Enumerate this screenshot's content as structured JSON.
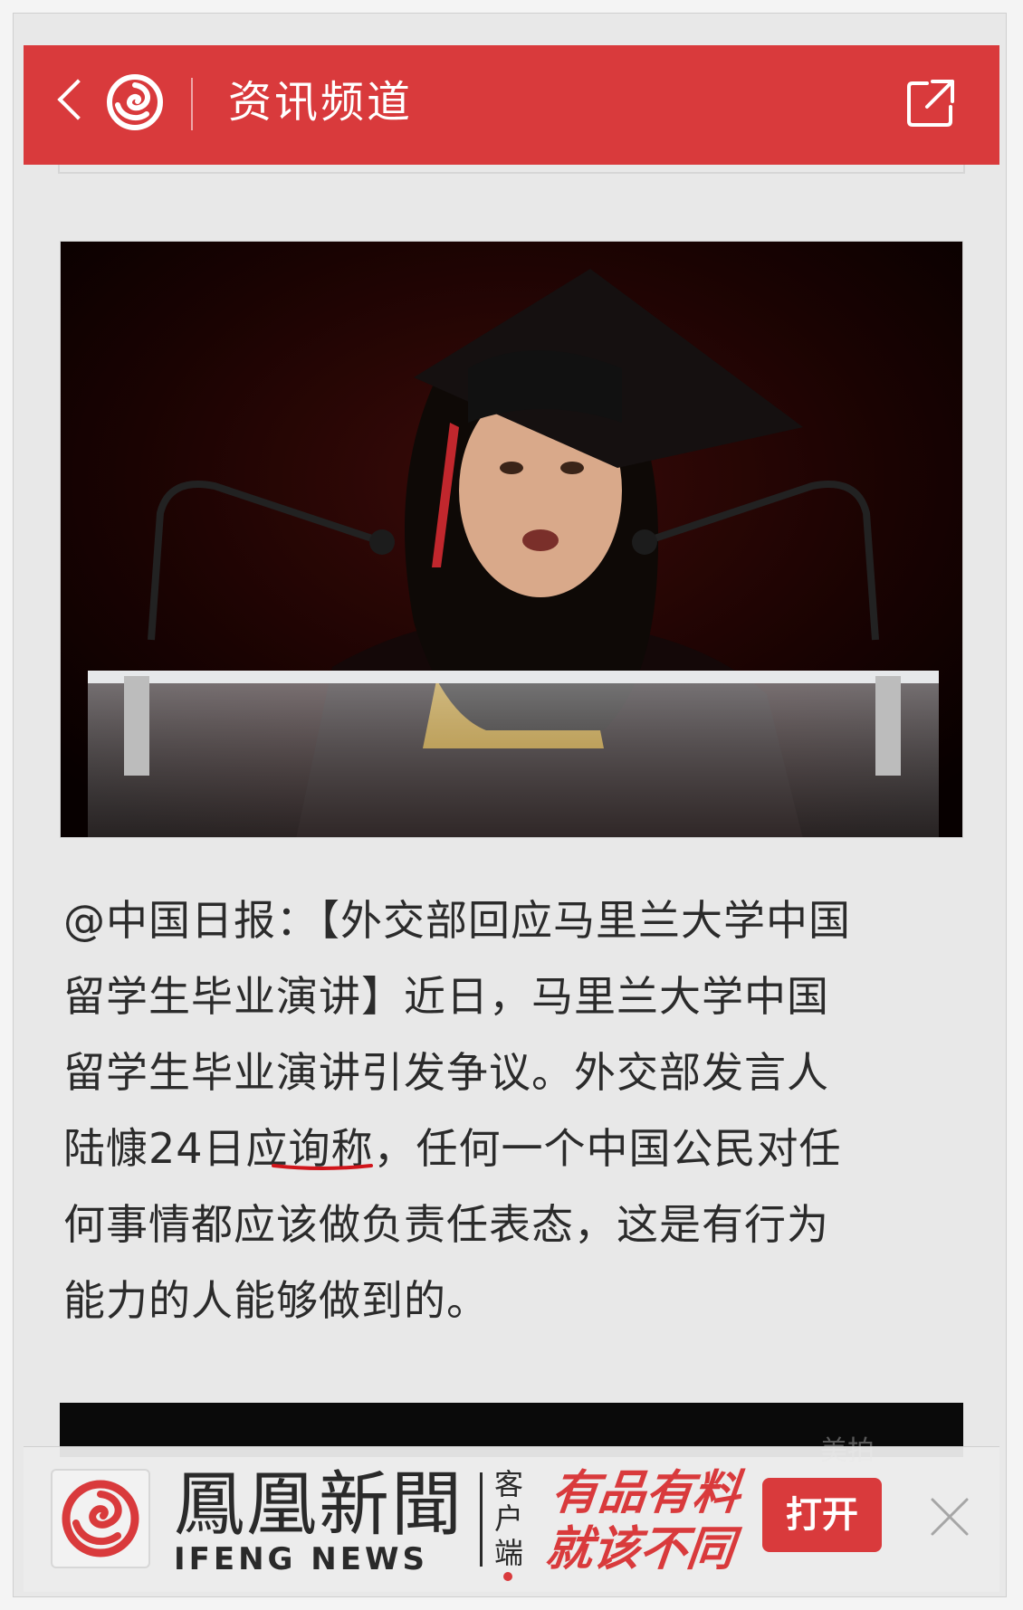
{
  "header": {
    "title": "资讯频道",
    "back_icon": "chevron-left-icon",
    "logo_icon": "ifeng-phoenix-logo",
    "share_icon": "share-external-icon",
    "background": "#d93a3c"
  },
  "article": {
    "lines": [
      "@中国日报：【外交部回应马里兰大学中国",
      "留学生毕业演讲】近日，马里兰大学中国",
      "留学生毕业演讲引发争议。外交部发言人",
      "陆慷24日应询称，任何一个中国公民对任",
      "何事情都应该做负责任表态，这是有行为",
      "能力的人能够做到的。"
    ]
  },
  "banner": {
    "brand_cn": "鳳凰新聞",
    "brand_en": "IFENG NEWS",
    "client_label": "客户端",
    "slogan_line1": "有品有料",
    "slogan_line2": "就该不同",
    "open_button": "打开",
    "close_icon": "close-icon"
  },
  "watermark": "美拍"
}
